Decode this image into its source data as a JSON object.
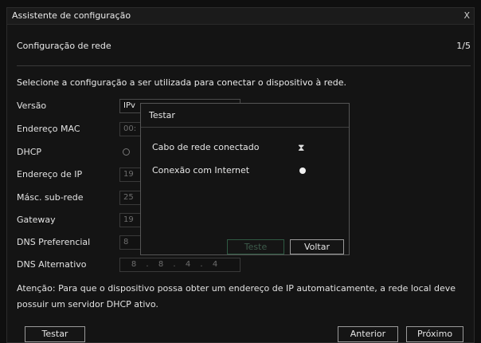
{
  "window": {
    "title": "Assistente de configuração",
    "close": "X"
  },
  "step": {
    "title": "Configuração de rede",
    "count": "1/5"
  },
  "description": "Selecione a configuração a ser utilizada para conectar o dispositivo à rede.",
  "form": {
    "version_label": "Versão",
    "version_value": "IPv",
    "mac_label": "Endereço MAC",
    "mac_value": "00:",
    "dhcp_label": "DHCP",
    "ip_label": "Endereço de IP",
    "ip_value": "19",
    "mask_label": "Másc. sub-rede",
    "mask_value": "25",
    "gateway_label": "Gateway",
    "gateway_value": "19",
    "dns_pref_label": "DNS Preferencial",
    "dns_pref_value": "8",
    "dns_alt_label": "DNS Alternativo",
    "dns_alt_octets": [
      "8",
      "8",
      "4",
      "4"
    ],
    "dot": "."
  },
  "note": "Atenção: Para que o dispositivo possa obter um endereço de IP automaticamente, a rede local deve possuir um servidor DHCP ativo.",
  "buttons": {
    "test": "Testar",
    "previous": "Anterior",
    "next": "Próximo"
  },
  "modal": {
    "title": "Testar",
    "cable_label": "Cabo de rede conectado",
    "cable_status_icon": "⧗",
    "internet_label": "Conexão com Internet",
    "test_button": "Teste",
    "back_button": "Voltar"
  }
}
